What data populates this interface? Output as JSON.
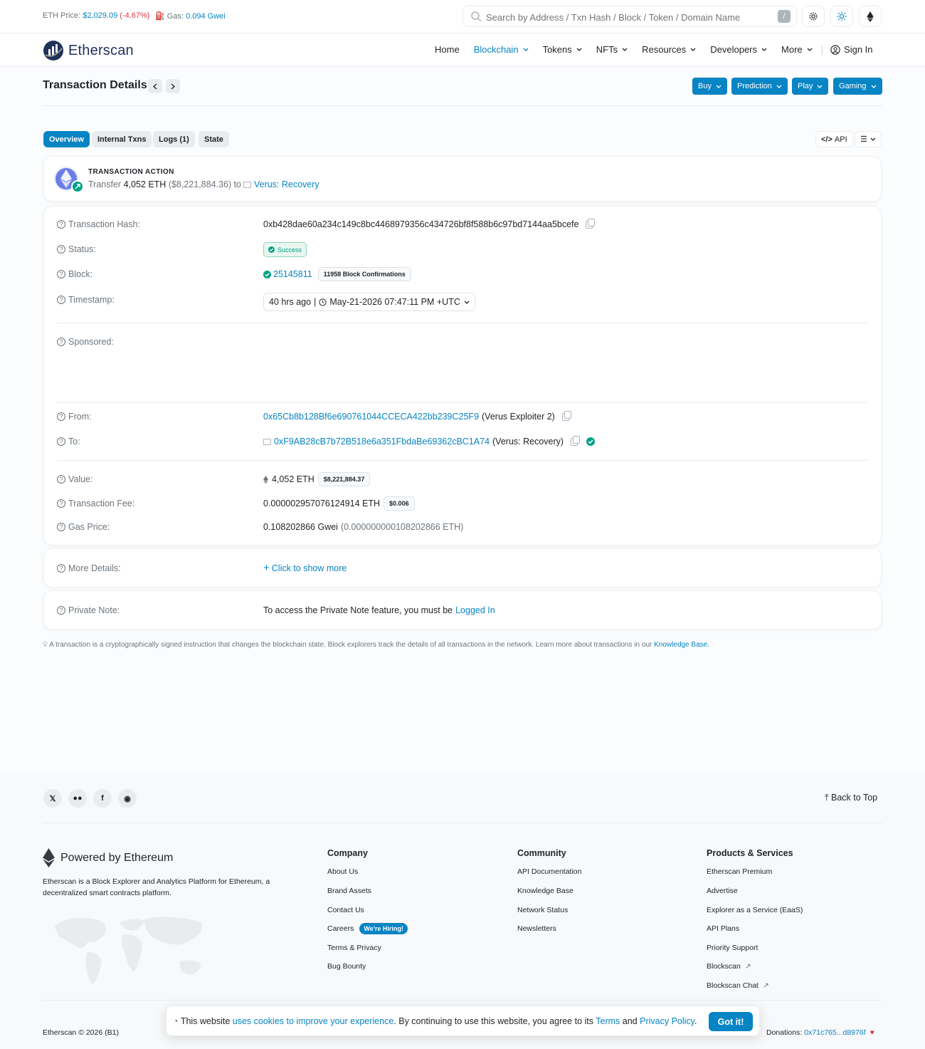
{
  "topbar": {
    "eth_price_label": "ETH Price:",
    "eth_price_value": "$2,029.09",
    "eth_price_change": "(-4.67%)",
    "gas_label": "Gas:",
    "gas_value": "0.094 Gwei",
    "search_placeholder": "Search by Address / Txn Hash / Block / Token / Domain Name",
    "search_shortcut": "/"
  },
  "nav": {
    "brand": "Etherscan",
    "items": [
      {
        "label": "Home"
      },
      {
        "label": "Blockchain"
      },
      {
        "label": "Tokens"
      },
      {
        "label": "NFTs"
      },
      {
        "label": "Resources"
      },
      {
        "label": "Developers"
      },
      {
        "label": "More"
      }
    ],
    "sign_in": "Sign In"
  },
  "page": {
    "title": "Transaction Details",
    "buttons": [
      "Buy",
      "Prediction",
      "Play",
      "Gaming"
    ]
  },
  "tabs": [
    "Overview",
    "Internal Txns",
    "Logs (1)",
    "State"
  ],
  "tools": {
    "api": "API"
  },
  "action": {
    "heading": "TRANSACTION ACTION",
    "prefix": "Transfer",
    "amount": "4,052 ETH",
    "usd": "($8,221,884.36)",
    "to_word": "to",
    "target": "Verus: Recovery"
  },
  "details": {
    "hash_label": "Transaction Hash:",
    "hash": "0xb428dae60a234c149c8bc4468979356c434726bf8f588b6c97bd7144aa5bcefe",
    "status_label": "Status:",
    "status": "Success",
    "block_label": "Block:",
    "block": "25145811",
    "confirmations": "11958 Block Confirmations",
    "timestamp_label": "Timestamp:",
    "timestamp_ago": "40 hrs ago",
    "timestamp_full": "May-21-2026 07:47:11 PM +UTC",
    "sponsored_label": "Sponsored:",
    "from_label": "From:",
    "from_address": "0x65Cb8b128Bf6e690761044CCECA422bb239C25F9",
    "from_name": "(Verus Exploiter 2)",
    "to_label": "To:",
    "to_address": "0xF9AB28cB7b72B518e6a351FbdaBe69362cBC1A74",
    "to_name": "(Verus: Recovery)",
    "value_label": "Value:",
    "value": "4,052 ETH",
    "value_usd": "$8,221,884.37",
    "fee_label": "Transaction Fee:",
    "fee": "0.000002957076124914 ETH",
    "fee_usd": "$0.006",
    "gas_price_label": "Gas Price:",
    "gas_price": "0.108202866 Gwei",
    "gas_price_eth": "(0.000000000108202866 ETH)"
  },
  "more": {
    "label": "More Details:",
    "link": "Click to show more"
  },
  "private_note": {
    "label": "Private Note:",
    "text": "To access the Private Note feature, you must be",
    "link": "Logged In"
  },
  "info_note": {
    "text": "A transaction is a cryptographically signed instruction that changes the blockchain state. Block explorers track the details of all transactions in the network. Learn more about transactions in our",
    "link": "Knowledge Base",
    "end": "."
  },
  "footer": {
    "back_to_top": "Back to Top",
    "social": [
      {
        "icon": "x-icon",
        "glyph": "𝕏"
      },
      {
        "icon": "medium-icon",
        "glyph": "●●"
      },
      {
        "icon": "facebook-icon",
        "glyph": "f"
      },
      {
        "icon": "reddit-icon",
        "glyph": "◉"
      }
    ],
    "powered": "Powered by Ethereum",
    "about": "Etherscan is a Block Explorer and Analytics Platform for Ethereum, a decentralized smart contracts platform.",
    "company_head": "Company",
    "company": [
      "About Us",
      "Brand Assets",
      "Contact Us",
      "Careers",
      "Terms & Privacy",
      "Bug Bounty"
    ],
    "hiring": "We're Hiring!",
    "community_head": "Community",
    "community": [
      "API Documentation",
      "Knowledge Base",
      "Network Status",
      "Newsletters"
    ],
    "products_head": "Products & Services",
    "products": [
      "Etherscan Premium",
      "Advertise",
      "Explorer as a Service (EaaS)",
      "API Plans",
      "Priority Support",
      "Blockscan",
      "Blockscan Chat"
    ],
    "copyright": "Etherscan © 2026 (B1)",
    "donations_label": "Donations:",
    "donations_addr": "0x71c765...d8976f"
  },
  "cookie": {
    "t1": "This website",
    "l1": "uses cookies to improve your experience",
    "t2": ". By continuing to use this website, you agree to its",
    "l2": "Terms",
    "t3": "and",
    "l3": "Privacy Policy",
    "t4": ".",
    "button": "Got it!"
  },
  "colors": {
    "accent": "#0784c3",
    "success": "#00a186",
    "negative": "#dc3545"
  }
}
